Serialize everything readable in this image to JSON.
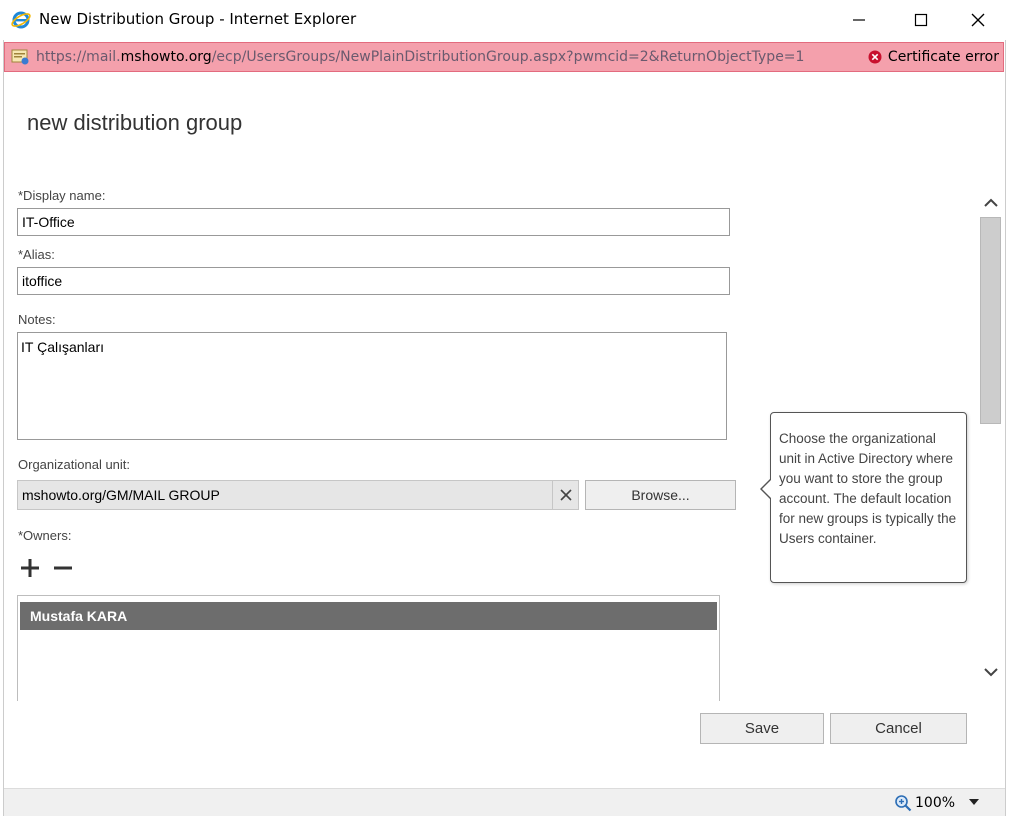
{
  "window": {
    "title": "New Distribution Group - Internet Explorer",
    "minimize": "minimize",
    "maximize": "maximize",
    "close": "close"
  },
  "address_bar": {
    "url_prefix": "https://mail.",
    "url_domain": "mshowto.org",
    "url_path": "/ecp/UsersGroups/NewPlainDistributionGroup.aspx?pwmcid=2&ReturnObjectType=1",
    "certificate_status": "Certificate error"
  },
  "dialog": {
    "title": "new distribution group"
  },
  "form": {
    "display_name_label": "*Display name:",
    "display_name_value": "IT-Office",
    "alias_label": "*Alias:",
    "alias_value": "itoffice",
    "notes_label": "Notes:",
    "notes_value": "IT Çalışanları",
    "org_unit_label": "Organizational unit:",
    "org_unit_value": "mshowto.org/GM/MAIL GROUP",
    "browse_label": "Browse...",
    "owners_label": "*Owners:",
    "owners": [
      "Mustafa KARA"
    ]
  },
  "tooltip": {
    "text": "Choose the organizational unit in Active Directory where you want to store the group account. The default location for new groups is typically the Users container."
  },
  "footer": {
    "save_label": "Save",
    "cancel_label": "Cancel"
  },
  "status_bar": {
    "zoom": "100%"
  },
  "colors": {
    "address_bar_bg": "#f4a0ac",
    "selected_row_bg": "#6d6d6d",
    "error_red": "#c8102e"
  }
}
